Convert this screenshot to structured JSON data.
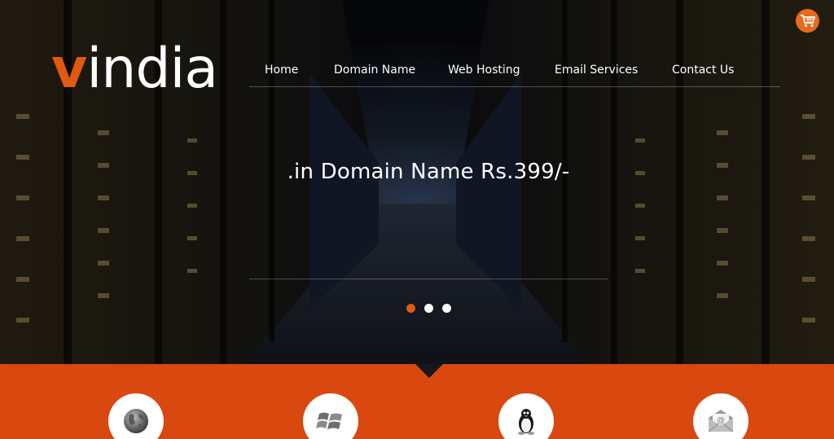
{
  "brand": {
    "logo_first": "v",
    "logo_rest": "india",
    "accent_color": "#e05a10"
  },
  "header": {
    "cart_icon": "shopping-cart-icon"
  },
  "nav": {
    "items": [
      {
        "label": "Home"
      },
      {
        "label": "Domain Name"
      },
      {
        "label": "Web Hosting"
      },
      {
        "label": "Email Services"
      },
      {
        "label": "Contact Us"
      }
    ]
  },
  "hero": {
    "headline": ".in Domain Name Rs.399/-",
    "slides": 3,
    "active_slide": 1
  },
  "features": {
    "strip_color": "#d9480f",
    "icons": [
      "globe-icon",
      "windows-icon",
      "linux-penguin-icon",
      "email-envelope-icon"
    ]
  }
}
